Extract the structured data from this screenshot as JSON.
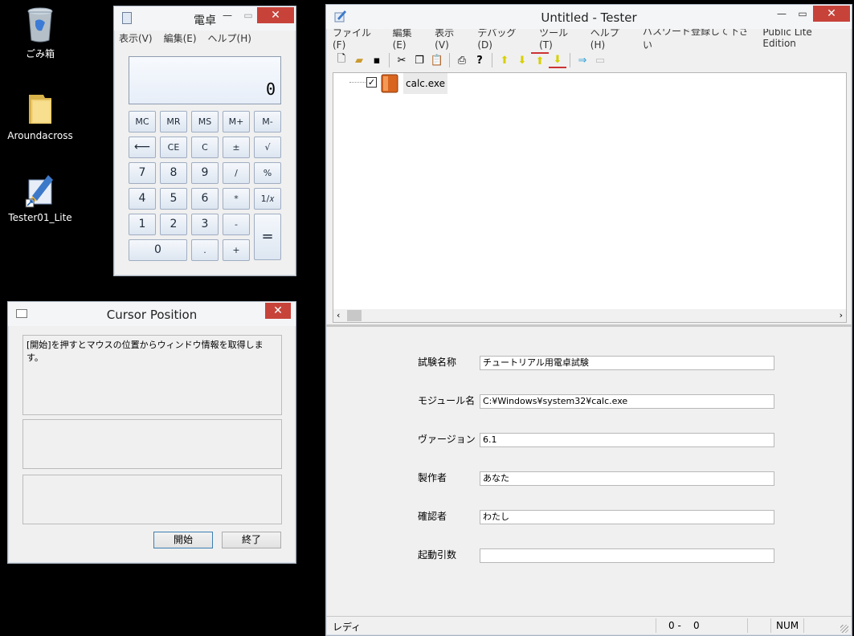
{
  "desktop": {
    "icons": [
      {
        "label": "ごみ箱"
      },
      {
        "label": "Aroundacross"
      },
      {
        "label": "Tester01_Lite"
      }
    ]
  },
  "calculator": {
    "title": "電卓",
    "menu": [
      "表示(V)",
      "編集(E)",
      "ヘルプ(H)"
    ],
    "display": "0",
    "buttons": {
      "mc": "MC",
      "mr": "MR",
      "ms": "MS",
      "mplus": "M+",
      "mminus": "M-",
      "back": "⟵",
      "ce": "CE",
      "c": "C",
      "pm": "±",
      "sqrt": "√",
      "n7": "7",
      "n8": "8",
      "n9": "9",
      "div": "/",
      "pct": "%",
      "n4": "4",
      "n5": "5",
      "n6": "6",
      "mul": "*",
      "inv": "1/𝑥",
      "n1": "1",
      "n2": "2",
      "n3": "3",
      "sub": "-",
      "eq": "=",
      "n0": "0",
      "dot": ".",
      "add": "+"
    }
  },
  "cursor": {
    "title": "Cursor Position",
    "message": "[開始]を押すとマウスの位置からウィンドウ情報を取得します。",
    "start": "開始",
    "end": "終了"
  },
  "tester": {
    "title": "Untitled - Tester",
    "menu": [
      "ファイル(F)",
      "編集(E)",
      "表示(V)",
      "デバッグ(D)",
      "ツール(T)",
      "ヘルプ(H)",
      "パスワード登録して下さい"
    ],
    "edition": "Public Lite Edition",
    "tree_item": "calc.exe",
    "fields": [
      {
        "label": "試験名称",
        "value": "チュートリアル用電卓試験"
      },
      {
        "label": "モジュール名",
        "value": "C:¥Windows¥system32¥calc.exe"
      },
      {
        "label": "ヴァージョン",
        "value": "6.1"
      },
      {
        "label": "製作者",
        "value": "あなた"
      },
      {
        "label": "確認者",
        "value": "わたし"
      },
      {
        "label": "起動引数",
        "value": ""
      }
    ],
    "status": {
      "ready": "レディ",
      "pos": "0 -    0",
      "num": "NUM"
    }
  }
}
